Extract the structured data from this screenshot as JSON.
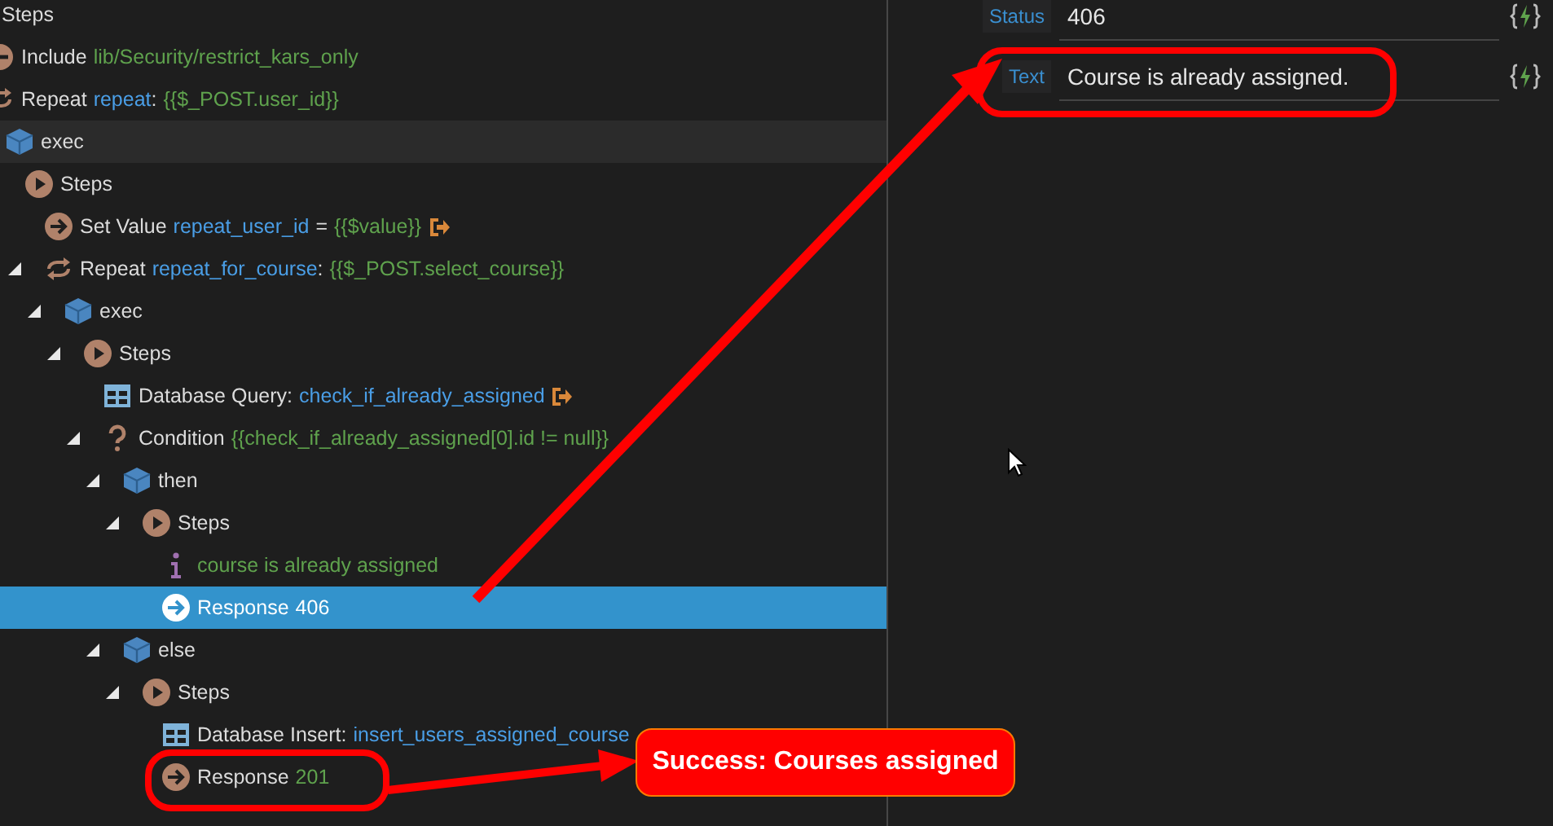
{
  "tree": [
    {
      "parts": [
        {
          "kind": "label",
          "text": "Steps"
        }
      ],
      "selected": false,
      "hovered": false,
      "children": [
        {
          "kind": "include",
          "parts": [
            {
              "kind": "label",
              "text": "Include"
            },
            {
              "kind": "expr",
              "text": "lib/Security/restrict_kars_only"
            }
          ],
          "selected": false,
          "hovered": false
        },
        {
          "kind": "repeat",
          "parts": [
            {
              "kind": "label",
              "text": "Repeat"
            },
            {
              "kind": "name",
              "text": "repeat"
            },
            {
              "kind": "punct",
              "text": ":"
            },
            {
              "kind": "expr",
              "text": "{{$_POST.user_id}}"
            }
          ],
          "selected": false,
          "hovered": false,
          "children": [
            {
              "kind": "exec",
              "parts": [
                {
                  "kind": "label",
                  "text": "exec"
                }
              ],
              "selected": false,
              "hovered": true,
              "children": [
                {
                  "kind": "steps",
                  "parts": [
                    {
                      "kind": "label",
                      "text": "Steps"
                    }
                  ],
                  "selected": false,
                  "hovered": false,
                  "children": [
                    {
                      "kind": "setvalue",
                      "parts": [
                        {
                          "kind": "label",
                          "text": "Set Value"
                        },
                        {
                          "kind": "name",
                          "text": "repeat_user_id"
                        },
                        {
                          "kind": "label",
                          "text": "="
                        },
                        {
                          "kind": "expr",
                          "text": "{{$value}}"
                        }
                      ],
                      "link": true,
                      "selected": false,
                      "hovered": false
                    },
                    {
                      "kind": "repeat",
                      "parts": [
                        {
                          "kind": "label",
                          "text": "Repeat"
                        },
                        {
                          "kind": "name",
                          "text": "repeat_for_course"
                        },
                        {
                          "kind": "punct",
                          "text": ":"
                        },
                        {
                          "kind": "expr",
                          "text": "{{$_POST.select_course}}"
                        }
                      ],
                      "expanded": true,
                      "selected": false,
                      "hovered": false,
                      "children": [
                        {
                          "kind": "exec",
                          "parts": [
                            {
                              "kind": "label",
                              "text": "exec"
                            }
                          ],
                          "expanded": true,
                          "selected": false,
                          "hovered": false,
                          "children": [
                            {
                              "kind": "steps",
                              "parts": [
                                {
                                  "kind": "label",
                                  "text": "Steps"
                                }
                              ],
                              "expanded": true,
                              "selected": false,
                              "hovered": false,
                              "children": [
                                {
                                  "kind": "query",
                                  "parts": [
                                    {
                                      "kind": "label",
                                      "text": "Database Query"
                                    },
                                    {
                                      "kind": "punct",
                                      "text": ":"
                                    },
                                    {
                                      "kind": "name",
                                      "text": "check_if_already_assigned"
                                    }
                                  ],
                                  "link": true,
                                  "selected": false,
                                  "hovered": false
                                },
                                {
                                  "kind": "condition",
                                  "parts": [
                                    {
                                      "kind": "label",
                                      "text": "Condition"
                                    },
                                    {
                                      "kind": "expr",
                                      "text": "{{check_if_already_assigned[0].id != null}}"
                                    }
                                  ],
                                  "expanded": true,
                                  "selected": false,
                                  "hovered": false,
                                  "children": [
                                    {
                                      "kind": "exec",
                                      "parts": [
                                        {
                                          "kind": "label",
                                          "text": "then"
                                        }
                                      ],
                                      "expanded": true,
                                      "selected": false,
                                      "hovered": false,
                                      "children": [
                                        {
                                          "kind": "steps",
                                          "parts": [
                                            {
                                              "kind": "label",
                                              "text": "Steps"
                                            }
                                          ],
                                          "expanded": true,
                                          "selected": false,
                                          "hovered": false,
                                          "children": [
                                            {
                                              "kind": "info",
                                              "parts": [
                                                {
                                                  "kind": "expr",
                                                  "text": "course is already assigned"
                                                }
                                              ],
                                              "selected": false,
                                              "hovered": false
                                            },
                                            {
                                              "kind": "response",
                                              "parts": [
                                                {
                                                  "kind": "label",
                                                  "text": "Response"
                                                },
                                                {
                                                  "kind": "expr",
                                                  "text": "406"
                                                }
                                              ],
                                              "selected": true,
                                              "hovered": false
                                            }
                                          ]
                                        }
                                      ]
                                    },
                                    {
                                      "kind": "exec",
                                      "parts": [
                                        {
                                          "kind": "label",
                                          "text": "else"
                                        }
                                      ],
                                      "expanded": true,
                                      "selected": false,
                                      "hovered": false,
                                      "children": [
                                        {
                                          "kind": "steps",
                                          "parts": [
                                            {
                                              "kind": "label",
                                              "text": "Steps"
                                            }
                                          ],
                                          "expanded": true,
                                          "selected": false,
                                          "hovered": false,
                                          "children": [
                                            {
                                              "kind": "query",
                                              "parts": [
                                                {
                                                  "kind": "label",
                                                  "text": "Database Insert"
                                                },
                                                {
                                                  "kind": "punct",
                                                  "text": ":"
                                                },
                                                {
                                                  "kind": "name",
                                                  "text": "insert_users_assigned_course"
                                                }
                                              ],
                                              "selected": false,
                                              "hovered": false
                                            },
                                            {
                                              "kind": "response",
                                              "parts": [
                                                {
                                                  "kind": "label",
                                                  "text": "Response"
                                                },
                                                {
                                                  "kind": "expr",
                                                  "text": "201"
                                                }
                                              ],
                                              "selected": false,
                                              "hovered": false
                                            }
                                          ]
                                        }
                                      ]
                                    }
                                  ]
                                }
                              ]
                            }
                          ]
                        }
                      ]
                    }
                  ]
                }
              ]
            }
          ]
        }
      ]
    }
  ],
  "properties": [
    {
      "label": "Status",
      "value": "406"
    },
    {
      "label": "Text",
      "value": "Course is already assigned."
    }
  ],
  "callout": "Success: Courses assigned"
}
